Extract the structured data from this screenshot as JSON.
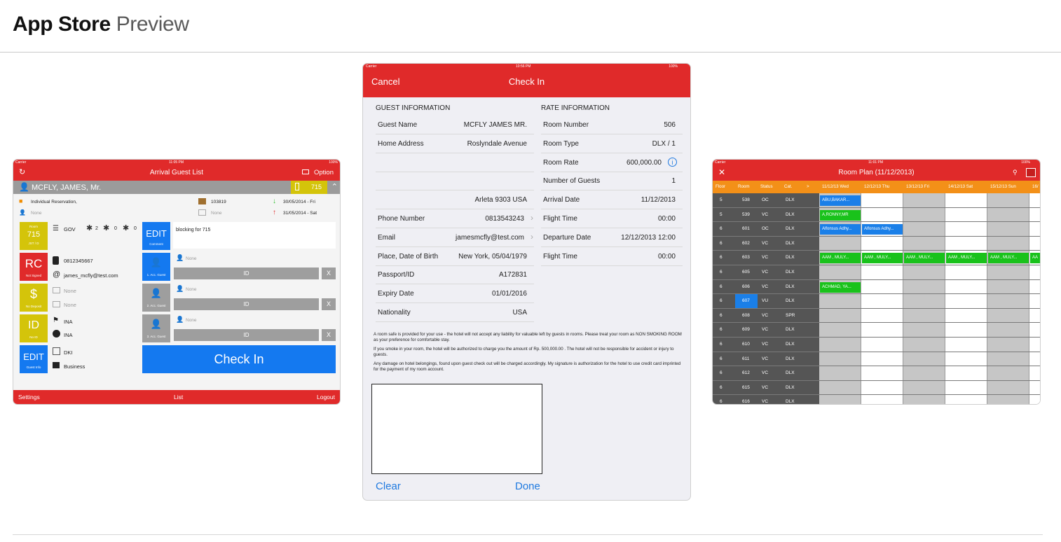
{
  "header": {
    "title_bold": "App Store",
    "title_light": "Preview"
  },
  "screen1": {
    "status": {
      "carrier": "Carrier",
      "time": "11:05 PM",
      "battery": "100%"
    },
    "nav": {
      "title": "Arrival Guest List",
      "option": "Option"
    },
    "guest_name": "MCFLY,  JAMES, Mr.",
    "room_badge": "715",
    "reservation_type": "Individual Reservation,",
    "none_1": "None",
    "booking_no": "103819",
    "none_2": "None",
    "arrival_date": "30/05/2014 - Fri",
    "departure_date": "31/05/2014 - Sat",
    "room_tile": {
      "label": "Room",
      "number": "715",
      "sub": "JST / D"
    },
    "segment": "GOV",
    "adults": "2",
    "children": "0",
    "infants": "0",
    "edit_comment": {
      "main": "EDIT",
      "sub": "Comment"
    },
    "comment": "blocking for 715",
    "rc_tile": {
      "main": "RC",
      "sub": "Not Signed"
    },
    "phone": "0812345667",
    "email": "james_mcfly@test.com",
    "deposit_tile": {
      "main": "$",
      "sub": "No Deposit"
    },
    "deposit_none_1": "None",
    "deposit_none_2": "None",
    "id_tile": {
      "main": "ID",
      "sub": "No ID"
    },
    "nationality_1": "INA",
    "nationality_2": "INA",
    "edit_guest": {
      "main": "EDIT",
      "sub": "Guest Info"
    },
    "city": "DKI",
    "purpose": "Business",
    "acc_guests": [
      {
        "label": "1. Acc. Guest",
        "name": "None",
        "id": "ID",
        "x": "X"
      },
      {
        "label": "2. Acc. Guest",
        "name": "None",
        "id": "ID",
        "x": "X"
      },
      {
        "label": "3. Acc. Guest",
        "name": "None",
        "id": "ID",
        "x": "X"
      }
    ],
    "check_in_button": "Check In",
    "footer": {
      "left": "Settings",
      "center": "List",
      "right": "Logout"
    },
    "colors": {
      "red": "#e02a2a",
      "yellow": "#d4c40a",
      "blue": "#1479f0",
      "grey": "#9b9b9b"
    }
  },
  "screen2": {
    "status": {
      "carrier": "Carrier",
      "time": "10:56 PM",
      "battery": "100%"
    },
    "nav": {
      "cancel": "Cancel",
      "title": "Check In"
    },
    "guest_section": "GUEST INFORMATION",
    "rate_section": "RATE INFORMATION",
    "guest_rows": [
      {
        "k": "Guest Name",
        "v": "MCFLY JAMES MR."
      },
      {
        "k": "Home Address",
        "v": "Roslyndale Avenue"
      },
      {
        "k": "",
        "v": ""
      },
      {
        "k": "",
        "v": ""
      },
      {
        "k": "",
        "v": "Arleta 9303 USA"
      },
      {
        "k": "Phone Number",
        "v": "0813543243"
      },
      {
        "k": "Email",
        "v": "jamesmcfly@test.com"
      },
      {
        "k": "Place, Date of Birth",
        "v": "New York, 05/04/1979"
      },
      {
        "k": "Passport/ID",
        "v": "A172831"
      },
      {
        "k": "Expiry Date",
        "v": "01/01/2016"
      },
      {
        "k": "Nationality",
        "v": "USA"
      }
    ],
    "rate_rows": [
      {
        "k": "Room Number",
        "v": "506"
      },
      {
        "k": "Room Type",
        "v": "DLX / 1"
      },
      {
        "k": "Room Rate",
        "v": "600,000.00"
      },
      {
        "k": "Number of Guests",
        "v": "1"
      },
      {
        "k": "Arrival Date",
        "v": "11/12/2013"
      },
      {
        "k": "Flight Time",
        "v": "00:00"
      },
      {
        "k": "Departure Date",
        "v": "12/12/2013 12:00"
      },
      {
        "k": "Flight Time",
        "v": "00:00"
      }
    ],
    "terms": [
      "A room safe is provided for your use - the hotel will not accept any liability for valuable left by guests in rooms. Please treat your room as NON SMOKING ROOM as your preference for comfortable stay.",
      "If you smoke in your room, the hotel will be authorized to charge you the amount of Rp. 500,000.00 . The hotel will not be responsible for accident or injury to guests.",
      "Any damage on hotel belongings, found upon guest check out will be charged accordingly. My signature is authorization for the hotel to use credit card imprinted for the payment of my room account."
    ],
    "clear": "Clear",
    "done": "Done"
  },
  "screen3": {
    "status": {
      "carrier": "Carrier",
      "time": "11:01 PM",
      "battery": "100%"
    },
    "nav": {
      "title": "Room Plan (11/12/2013)"
    },
    "columns": [
      "Floor",
      "Room",
      "Status",
      "Cat.",
      ">",
      "11/12/13 Wed",
      "12/12/13 Thu",
      "13/12/13 Fri",
      "14/12/13 Sat",
      "15/12/13 Sun",
      "16/"
    ],
    "rows": [
      {
        "floor": "5",
        "room": "538",
        "status": "OC",
        "cat": "DLX"
      },
      {
        "floor": "5",
        "room": "539",
        "status": "VC",
        "cat": "DLX"
      },
      {
        "floor": "6",
        "room": "601",
        "status": "OC",
        "cat": "DLX"
      },
      {
        "floor": "6",
        "room": "602",
        "status": "VC",
        "cat": "DLX"
      },
      {
        "floor": "6",
        "room": "603",
        "status": "VC",
        "cat": "DLX"
      },
      {
        "floor": "6",
        "room": "605",
        "status": "VC",
        "cat": "DLX"
      },
      {
        "floor": "6",
        "room": "606",
        "status": "VC",
        "cat": "DLX"
      },
      {
        "floor": "6",
        "room": "607",
        "status": "VU",
        "cat": "DLX"
      },
      {
        "floor": "6",
        "room": "608",
        "status": "VC",
        "cat": "SPR"
      },
      {
        "floor": "6",
        "room": "609",
        "status": "VC",
        "cat": "DLX"
      },
      {
        "floor": "6",
        "room": "610",
        "status": "VC",
        "cat": "DLX"
      },
      {
        "floor": "6",
        "room": "611",
        "status": "VC",
        "cat": "DLX"
      },
      {
        "floor": "6",
        "room": "612",
        "status": "VC",
        "cat": "DLX"
      },
      {
        "floor": "6",
        "room": "615",
        "status": "VC",
        "cat": "DLX"
      },
      {
        "floor": "6",
        "room": "616",
        "status": "VC",
        "cat": "DLX"
      }
    ],
    "bookings": [
      {
        "row": 0,
        "col": 0,
        "span": 1,
        "text": "ABU,BAKAR...",
        "color": "#1a7fe8"
      },
      {
        "row": 1,
        "col": 0,
        "span": 1,
        "text": "A,RONNY,MR",
        "color": "#19c21b"
      },
      {
        "row": 2,
        "col": 0,
        "span": 1,
        "text": "Alfonsus Adhy...",
        "color": "#1a7fe8"
      },
      {
        "row": 2,
        "col": 1,
        "span": 1,
        "text": "Alfonsus Adhy...",
        "color": "#1a7fe8"
      },
      {
        "row": 4,
        "col": 0,
        "span": 1,
        "text": "AAM , MULY...",
        "color": "#19c21b"
      },
      {
        "row": 4,
        "col": 1,
        "span": 1,
        "text": "AAM , MULY...",
        "color": "#19c21b"
      },
      {
        "row": 4,
        "col": 2,
        "span": 1,
        "text": "AAM , MULY...",
        "color": "#19c21b"
      },
      {
        "row": 4,
        "col": 3,
        "span": 1,
        "text": "AAM , MULY...",
        "color": "#19c21b"
      },
      {
        "row": 4,
        "col": 4,
        "span": 1,
        "text": "AAM , MULY...",
        "color": "#19c21b"
      },
      {
        "row": 4,
        "col": 5,
        "span": 1,
        "text": "AA",
        "color": "#19c21b"
      },
      {
        "row": 6,
        "col": 0,
        "span": 1,
        "text": "ACHMAD, YA...",
        "color": "#19c21b"
      }
    ]
  }
}
